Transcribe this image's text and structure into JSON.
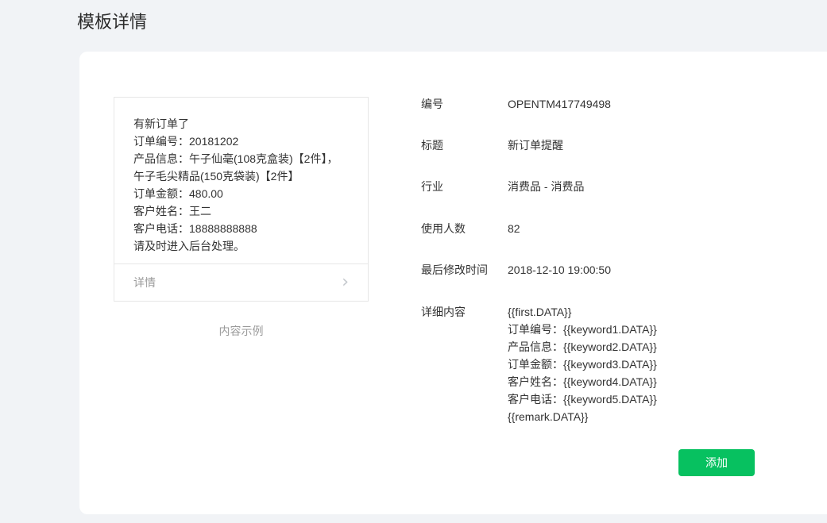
{
  "page": {
    "title": "模板详情"
  },
  "colors": {
    "accent_green": "#07C160",
    "page_background": "#f1f3f6"
  },
  "preview_card": {
    "lines": [
      "有新订单了",
      "订单编号：20181202",
      "产品信息：午子仙毫(108克盒装)【2件】，",
      "午子毛尖精品(150克袋装)【2件】",
      "订单金额：480.00",
      "客户姓名：王二",
      "客户电话：18888888888",
      "请及时进入后台处理。"
    ],
    "footer_label": "详情",
    "chevron_glyph": "›",
    "caption": "内容示例"
  },
  "details": {
    "fields": [
      {
        "label": "编号",
        "value": "OPENTM417749498"
      },
      {
        "label": "标题",
        "value": "新订单提醒"
      },
      {
        "label": "行业",
        "value": "消费品 - 消费品"
      },
      {
        "label": "使用人数",
        "value": "82"
      },
      {
        "label": "最后修改时间",
        "value": "2018-12-10 19:00:50"
      },
      {
        "label": "详细内容",
        "value_lines": [
          "{{first.DATA}}",
          "订单编号：{{keyword1.DATA}}",
          "产品信息：{{keyword2.DATA}}",
          "订单金额：{{keyword3.DATA}}",
          "客户姓名：{{keyword4.DATA}}",
          "客户电话：{{keyword5.DATA}}",
          "{{remark.DATA}}"
        ]
      }
    ],
    "add_button_label": "添加"
  }
}
